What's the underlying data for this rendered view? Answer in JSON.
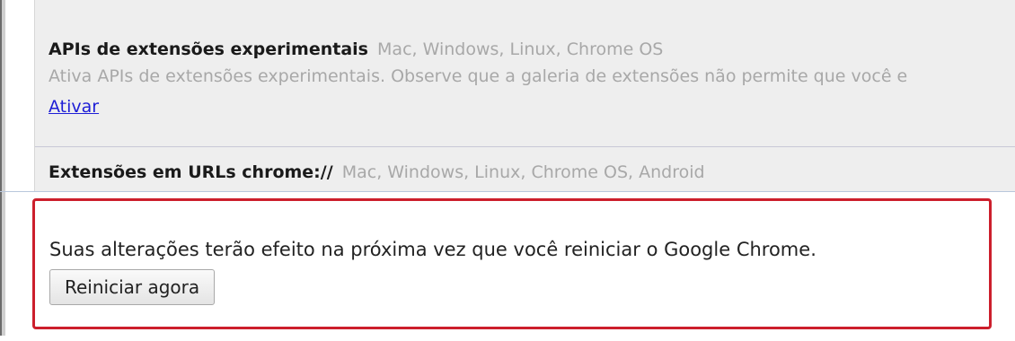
{
  "experiments": [
    {
      "name": "APIs de extensões experimentais",
      "platforms": "Mac, Windows, Linux, Chrome OS",
      "description": "Ativa APIs de extensões experimentais. Observe que a galeria de extensões não permite que você e",
      "action_label": "Ativar"
    },
    {
      "name": "Extensões em URLs chrome://",
      "platforms": "Mac, Windows, Linux, Chrome OS, Android"
    }
  ],
  "restart_panel": {
    "message": "Suas alterações terão efeito na próxima vez que você reiniciar o Google Chrome.",
    "button_label": "Reiniciar agora",
    "border_color": "#cc1f2c"
  }
}
